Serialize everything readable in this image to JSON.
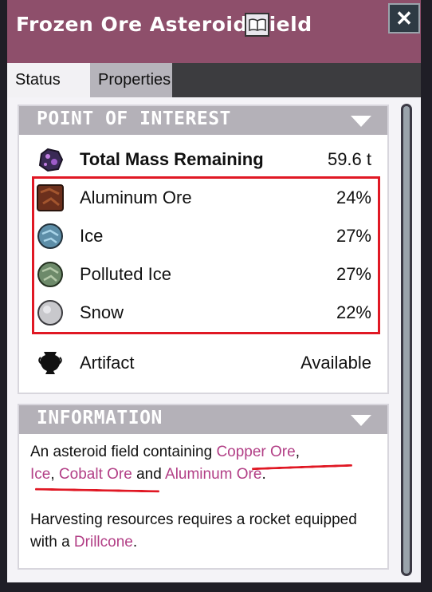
{
  "window": {
    "title": "Frozen Ore Asteroid Field",
    "close_glyph": "✕"
  },
  "tabs": [
    {
      "label": "Status",
      "active": true
    },
    {
      "label": "Properties",
      "active": false
    }
  ],
  "poi_section": {
    "title": "POINT OF INTEREST",
    "total": {
      "label": "Total Mass Remaining",
      "value": "59.6 t",
      "icon": "asteroid-icon"
    },
    "resources": [
      {
        "label": "Aluminum Ore",
        "value": "24%",
        "icon": "aluminum-ore-icon"
      },
      {
        "label": "Ice",
        "value": "27%",
        "icon": "ice-icon"
      },
      {
        "label": "Polluted Ice",
        "value": "27%",
        "icon": "polluted-ice-icon"
      },
      {
        "label": "Snow",
        "value": "22%",
        "icon": "snow-icon"
      }
    ],
    "artifact": {
      "label": "Artifact",
      "value": "Available",
      "icon": "artifact-urn-icon"
    }
  },
  "info_section": {
    "title": "INFORMATION",
    "p1": {
      "lead": "An asteroid field containing ",
      "link1": "Copper Ore",
      "sep1": ",",
      "link2": "Ice",
      "sep2": ", ",
      "link3": "Cobalt Ore",
      "mid": " and ",
      "link4": "Aluminum Ore",
      "end": "."
    },
    "p2": {
      "text": "Harvesting resources requires a rocket equipped with a ",
      "link": "Drillcone",
      "end": "."
    }
  },
  "colors": {
    "title_bar": "#8e4f6b",
    "link": "#b23f86",
    "highlight": "#e01824"
  }
}
